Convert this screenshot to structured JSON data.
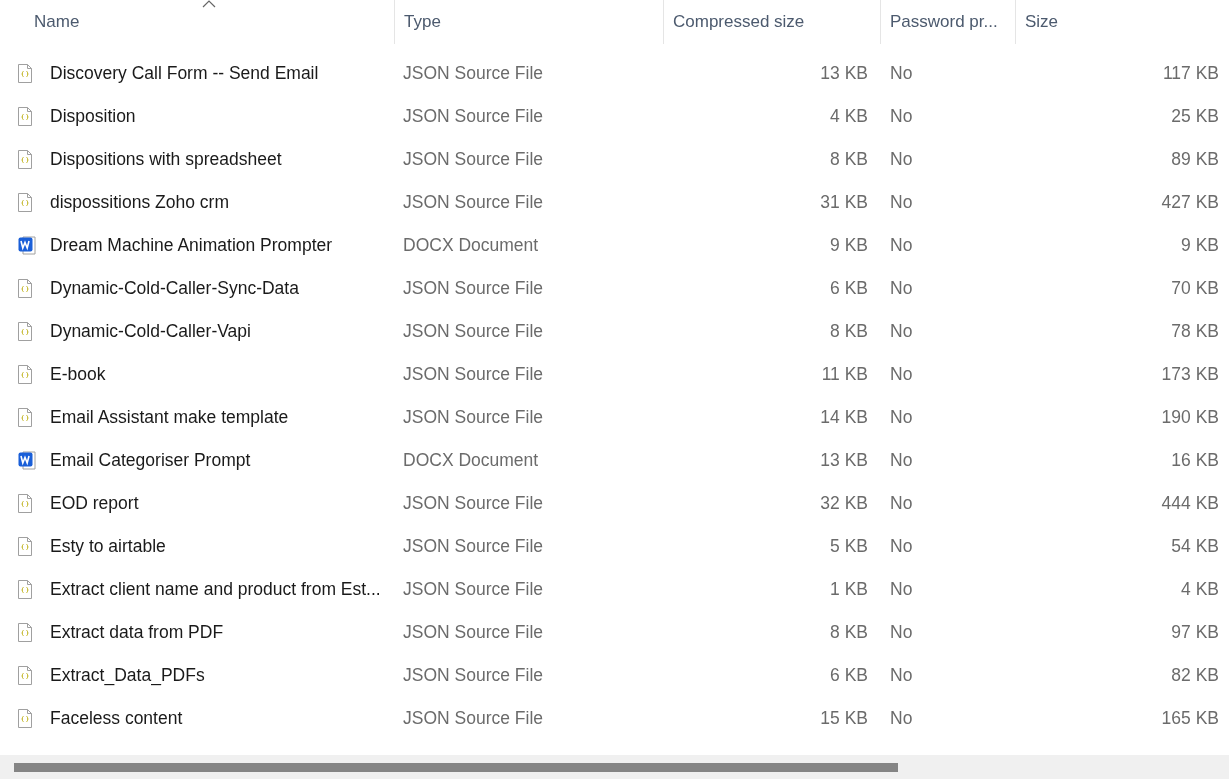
{
  "columns": [
    {
      "label": "Name",
      "sorted": true
    },
    {
      "label": "Type",
      "sorted": false
    },
    {
      "label": "Compressed size",
      "sorted": false
    },
    {
      "label": "Password pr...",
      "sorted": false
    },
    {
      "label": "Size",
      "sorted": false
    }
  ],
  "files": [
    {
      "name": "Discovery Call Form -- Send Email",
      "kind": "json",
      "type": "JSON Source File",
      "compressed": "13 KB",
      "password": "No",
      "size": "117 KB"
    },
    {
      "name": "Disposition",
      "kind": "json",
      "type": "JSON Source File",
      "compressed": "4 KB",
      "password": "No",
      "size": "25 KB"
    },
    {
      "name": "Dispositions with spreadsheet",
      "kind": "json",
      "type": "JSON Source File",
      "compressed": "8 KB",
      "password": "No",
      "size": "89 KB"
    },
    {
      "name": "dispossitions Zoho crm",
      "kind": "json",
      "type": "JSON Source File",
      "compressed": "31 KB",
      "password": "No",
      "size": "427 KB"
    },
    {
      "name": "Dream Machine Animation Prompter",
      "kind": "docx",
      "type": "DOCX Document",
      "compressed": "9 KB",
      "password": "No",
      "size": "9 KB"
    },
    {
      "name": "Dynamic-Cold-Caller-Sync-Data",
      "kind": "json",
      "type": "JSON Source File",
      "compressed": "6 KB",
      "password": "No",
      "size": "70 KB"
    },
    {
      "name": "Dynamic-Cold-Caller-Vapi",
      "kind": "json",
      "type": "JSON Source File",
      "compressed": "8 KB",
      "password": "No",
      "size": "78 KB"
    },
    {
      "name": "E-book",
      "kind": "json",
      "type": "JSON Source File",
      "compressed": "11 KB",
      "password": "No",
      "size": "173 KB"
    },
    {
      "name": "Email Assistant make template",
      "kind": "json",
      "type": "JSON Source File",
      "compressed": "14 KB",
      "password": "No",
      "size": "190 KB"
    },
    {
      "name": "Email Categoriser Prompt",
      "kind": "docx",
      "type": "DOCX Document",
      "compressed": "13 KB",
      "password": "No",
      "size": "16 KB"
    },
    {
      "name": "EOD report",
      "kind": "json",
      "type": "JSON Source File",
      "compressed": "32 KB",
      "password": "No",
      "size": "444 KB"
    },
    {
      "name": "Esty to airtable",
      "kind": "json",
      "type": "JSON Source File",
      "compressed": "5 KB",
      "password": "No",
      "size": "54 KB"
    },
    {
      "name": "Extract client name and product from Est...",
      "kind": "json",
      "type": "JSON Source File",
      "compressed": "1 KB",
      "password": "No",
      "size": "4 KB"
    },
    {
      "name": "Extract data from PDF",
      "kind": "json",
      "type": "JSON Source File",
      "compressed": "8 KB",
      "password": "No",
      "size": "97 KB"
    },
    {
      "name": "Extract_Data_PDFs",
      "kind": "json",
      "type": "JSON Source File",
      "compressed": "6 KB",
      "password": "No",
      "size": "82 KB"
    },
    {
      "name": "Faceless content",
      "kind": "json",
      "type": "JSON Source File",
      "compressed": "15 KB",
      "password": "No",
      "size": "165 KB"
    }
  ]
}
